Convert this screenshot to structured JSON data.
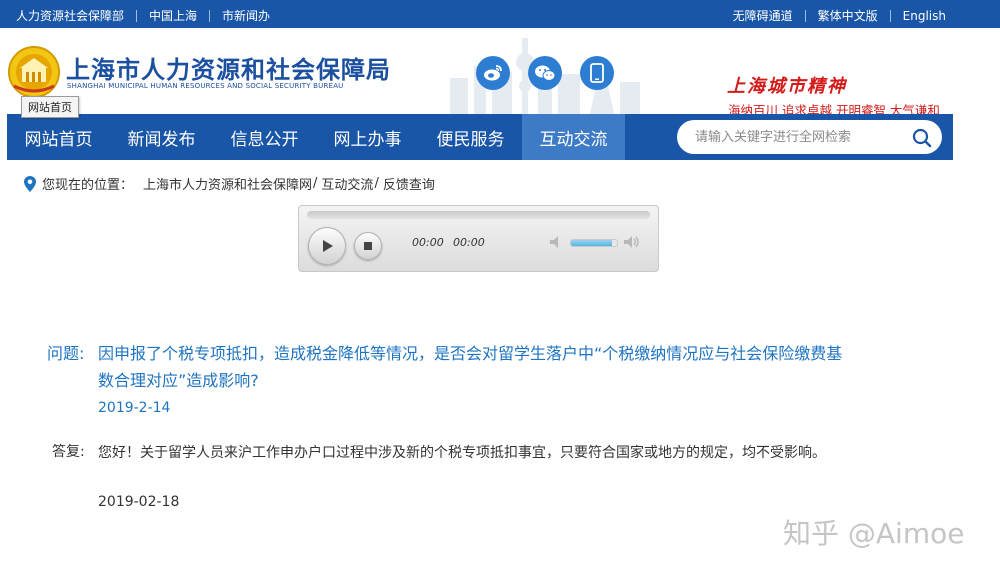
{
  "topbar": {
    "links_left": [
      "人力资源社会保障部",
      "中国上海",
      "市新闻办"
    ],
    "links_right": [
      "无障碍通道",
      "繁体中文版",
      "English"
    ]
  },
  "header": {
    "title": "上海市人力资源和社会保障局",
    "subtitle": "SHANGHAI MUNICIPAL HUMAN RESOURCES AND SOCIAL SECURITY BUREAU",
    "tooltip": "网站首页",
    "social_icons": [
      "weibo-icon",
      "wechat-icon",
      "mobile-icon"
    ],
    "spirit_title": "上海城市精神",
    "spirit_sub": "海纳百川 追求卓越 开明睿智 大气谦和"
  },
  "nav": {
    "items": [
      "网站首页",
      "新闻发布",
      "信息公开",
      "网上办事",
      "便民服务",
      "互动交流"
    ],
    "active_index": 5,
    "search_placeholder": "请输入关键字进行全网检索"
  },
  "breadcrumb": {
    "label": "您现在的位置：",
    "items": [
      "上海市人力资源和社会保障网",
      "互动交流",
      "反馈查询"
    ]
  },
  "player": {
    "current_time": "00:00",
    "total_time": "00:00",
    "volume_fraction": 0.9
  },
  "qa": {
    "question_label": "问题:",
    "question": "因申报了个税专项抵扣，造成税金降低等情况，是否会对留学生落户中“个税缴纳情况应与社会保险缴费基数合理对应”造成影响?",
    "question_date": "2019-2-14",
    "answer_label": "答复:",
    "answer": "您好！关于留学人员来沪工作申办户口过程中涉及新的个税专项抵扣事宜，只要符合国家或地方的规定，均不受影响。",
    "answer_date": "2019-02-18"
  },
  "watermark": "知乎 @Aimoe",
  "colors": {
    "brand_blue": "#1a56a8",
    "active_nav": "#3e7bc6",
    "question_blue": "#1f74c2",
    "spirit_red": "#d51a1a"
  }
}
